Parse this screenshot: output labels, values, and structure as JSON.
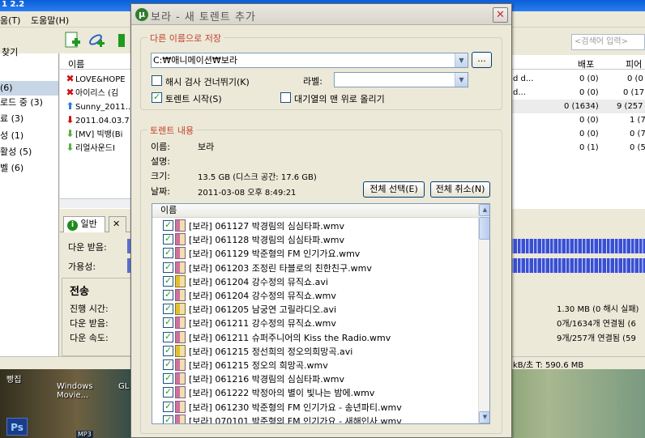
{
  "background": {
    "title_fragment": "1 2.2",
    "menu": [
      "움(T)",
      "도움말(H)"
    ],
    "search_placeholder": "<검색어 입력>",
    "sidebar": {
      "top_label": "찾기",
      "items": [
        "(6)",
        "로드 중 (3)",
        "료 (3)",
        "성 (1)",
        "활성 (5)",
        "벨 (6)"
      ]
    },
    "file_list": {
      "header_name": "이름",
      "rows": [
        {
          "icon": "x",
          "name": "LOVE&HOPE"
        },
        {
          "icon": "x",
          "name": "아이리스 (김"
        },
        {
          "icon": "up",
          "name": "Sunny_2011..."
        },
        {
          "icon": "down",
          "name": "2011.04.03.7"
        },
        {
          "icon": "down-green",
          "name": "[MV] 빅뱅(Bi"
        },
        {
          "icon": "down-green",
          "name": "리얼사운드I"
        }
      ]
    },
    "right_columns": {
      "seeds_header": "배포",
      "peers_header": "피어",
      "rows": [
        {
          "extra": "d d...",
          "seeds": "0 (0)",
          "peers": "0 (0"
        },
        {
          "extra": "d...",
          "seeds": "0 (0)",
          "peers": "0 (17"
        },
        {
          "extra": "",
          "seeds": "0 (1634)",
          "peers": "9 (257"
        },
        {
          "extra": "",
          "seeds": "0 (0)",
          "peers": "1 (7"
        },
        {
          "extra": "",
          "seeds": "0 (0)",
          "peers": "0 (7"
        },
        {
          "extra": "",
          "seeds": "0 (1)",
          "peers": "0 (5"
        }
      ]
    },
    "tabs": {
      "general": "일반"
    },
    "info_panel": {
      "downloaded_label": "다운 받음:",
      "availability_label": "가용성:",
      "transfer_header": "전송",
      "elapsed_label": "진행 시간:",
      "downloaded2_label": "다운 받음:",
      "down_speed_label": "다운 속도:",
      "right_line1": "1.30 MB (0 해시 실패)",
      "right_line2": "0개/1634개 연결됨 (6",
      "right_line3": "9개/257개 연결됨 (59"
    },
    "status": {
      "text": "kB/초 T: 590.6 MB"
    },
    "desktop": {
      "icon1": "빵집",
      "icon2": "Windows\nMovie...",
      "icon3": "GL",
      "ps": "Ps",
      "mp3": "MP3"
    }
  },
  "dialog": {
    "title": "보라 - 새 토렌트 추가",
    "logo": "µ",
    "save_group": {
      "legend": "다른 이름으로 저장",
      "path_value": "C:₩애니메이션₩보라",
      "browse_label": "...",
      "skip_hash_label": "해시 검사 건너뛰기(K)",
      "skip_hash_checked": false,
      "start_torrent_label": "토렌트 시작(S)",
      "start_torrent_checked": true,
      "label_label": "라벨:",
      "label_value": "",
      "queue_top_label": "대기열의 맨 위로 올리기",
      "queue_top_checked": false
    },
    "content_group": {
      "legend": "토렌트 내용",
      "name_label": "이름:",
      "name_value": "보라",
      "desc_label": "설명:",
      "desc_value": "",
      "size_label": "크기:",
      "size_value": "13.5 GB (디스크 공간: 17.6 GB)",
      "date_label": "날짜:",
      "date_value": "2011-03-08 오후 8:49:21",
      "select_all_label": "전체 선택(E)",
      "deselect_all_label": "전체 취소(N)",
      "column_name": "이름",
      "files": [
        {
          "name": "[보라] 061127 박경림의 심심타파.wmv",
          "type": "wmv"
        },
        {
          "name": "[보라] 061128 박경림의 심심타파.wmv",
          "type": "wmv"
        },
        {
          "name": "[보라] 061129 박준형의 FM 인기가요.wmv",
          "type": "wmv"
        },
        {
          "name": "[보라] 061203 조정린 타블로의 친한친구.wmv",
          "type": "wmv"
        },
        {
          "name": "[보라] 061204 강수정의 뮤직쇼.avi",
          "type": "avi"
        },
        {
          "name": "[보라] 061204 강수정의 뮤직쇼.wmv",
          "type": "wmv"
        },
        {
          "name": "[보라] 061205 남궁연 고릴라디오.avi",
          "type": "avi"
        },
        {
          "name": "[보라] 061211 강수정의 뮤직쇼.wmv",
          "type": "wmv"
        },
        {
          "name": "[보라] 061211 슈퍼주니어의 Kiss the Radio.wmv",
          "type": "wmv"
        },
        {
          "name": "[보라] 061215 정선희의 정오의희망곡.avi",
          "type": "avi"
        },
        {
          "name": "[보라] 061215 정오의 희망곡.wmv",
          "type": "wmv"
        },
        {
          "name": "[보라] 061216 박경림의 심심타파.wmv",
          "type": "wmv"
        },
        {
          "name": "[보라] 061222 박정아의 별이 빛나는 밤에.wmv",
          "type": "wmv"
        },
        {
          "name": "[보라] 061230 박준형의 FM 인기가요 - 송년파티.wmv",
          "type": "wmv"
        },
        {
          "name": "[보라] 070101 박준형의 FM 인기가요 - 새해인사.wmv",
          "type": "wmv"
        }
      ]
    }
  }
}
